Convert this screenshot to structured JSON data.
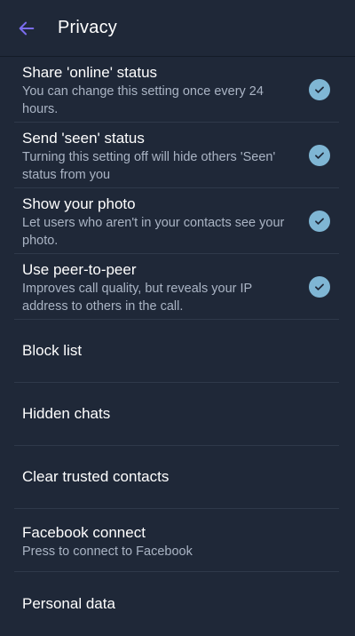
{
  "header": {
    "title": "Privacy",
    "back_icon": "arrow-left-icon",
    "accent_color": "#7b6df0"
  },
  "toggles": [
    {
      "title": "Share 'online' status",
      "subtitle": "You can change this setting once every 24 hours.",
      "checked": true,
      "icon": "check-circle-icon"
    },
    {
      "title": "Send 'seen' status",
      "subtitle": "Turning this setting off will hide others 'Seen' status from you",
      "checked": true,
      "icon": "check-circle-icon"
    },
    {
      "title": "Show your photo",
      "subtitle": "Let users who aren't in your contacts see your photo.",
      "checked": true,
      "icon": "check-circle-icon"
    },
    {
      "title": "Use peer-to-peer",
      "subtitle": "Improves call quality, but reveals your IP address to others in the call.",
      "checked": true,
      "icon": "check-circle-icon"
    }
  ],
  "items": [
    {
      "title": "Block list"
    },
    {
      "title": "Hidden chats"
    },
    {
      "title": "Clear trusted contacts"
    },
    {
      "title": "Facebook connect",
      "subtitle": "Press to connect to Facebook"
    },
    {
      "title": "Personal data"
    }
  ],
  "colors": {
    "background": "#1f2838",
    "divider": "#2f394a",
    "subtitle": "#aab4c4",
    "check": "#7fb6d4"
  }
}
